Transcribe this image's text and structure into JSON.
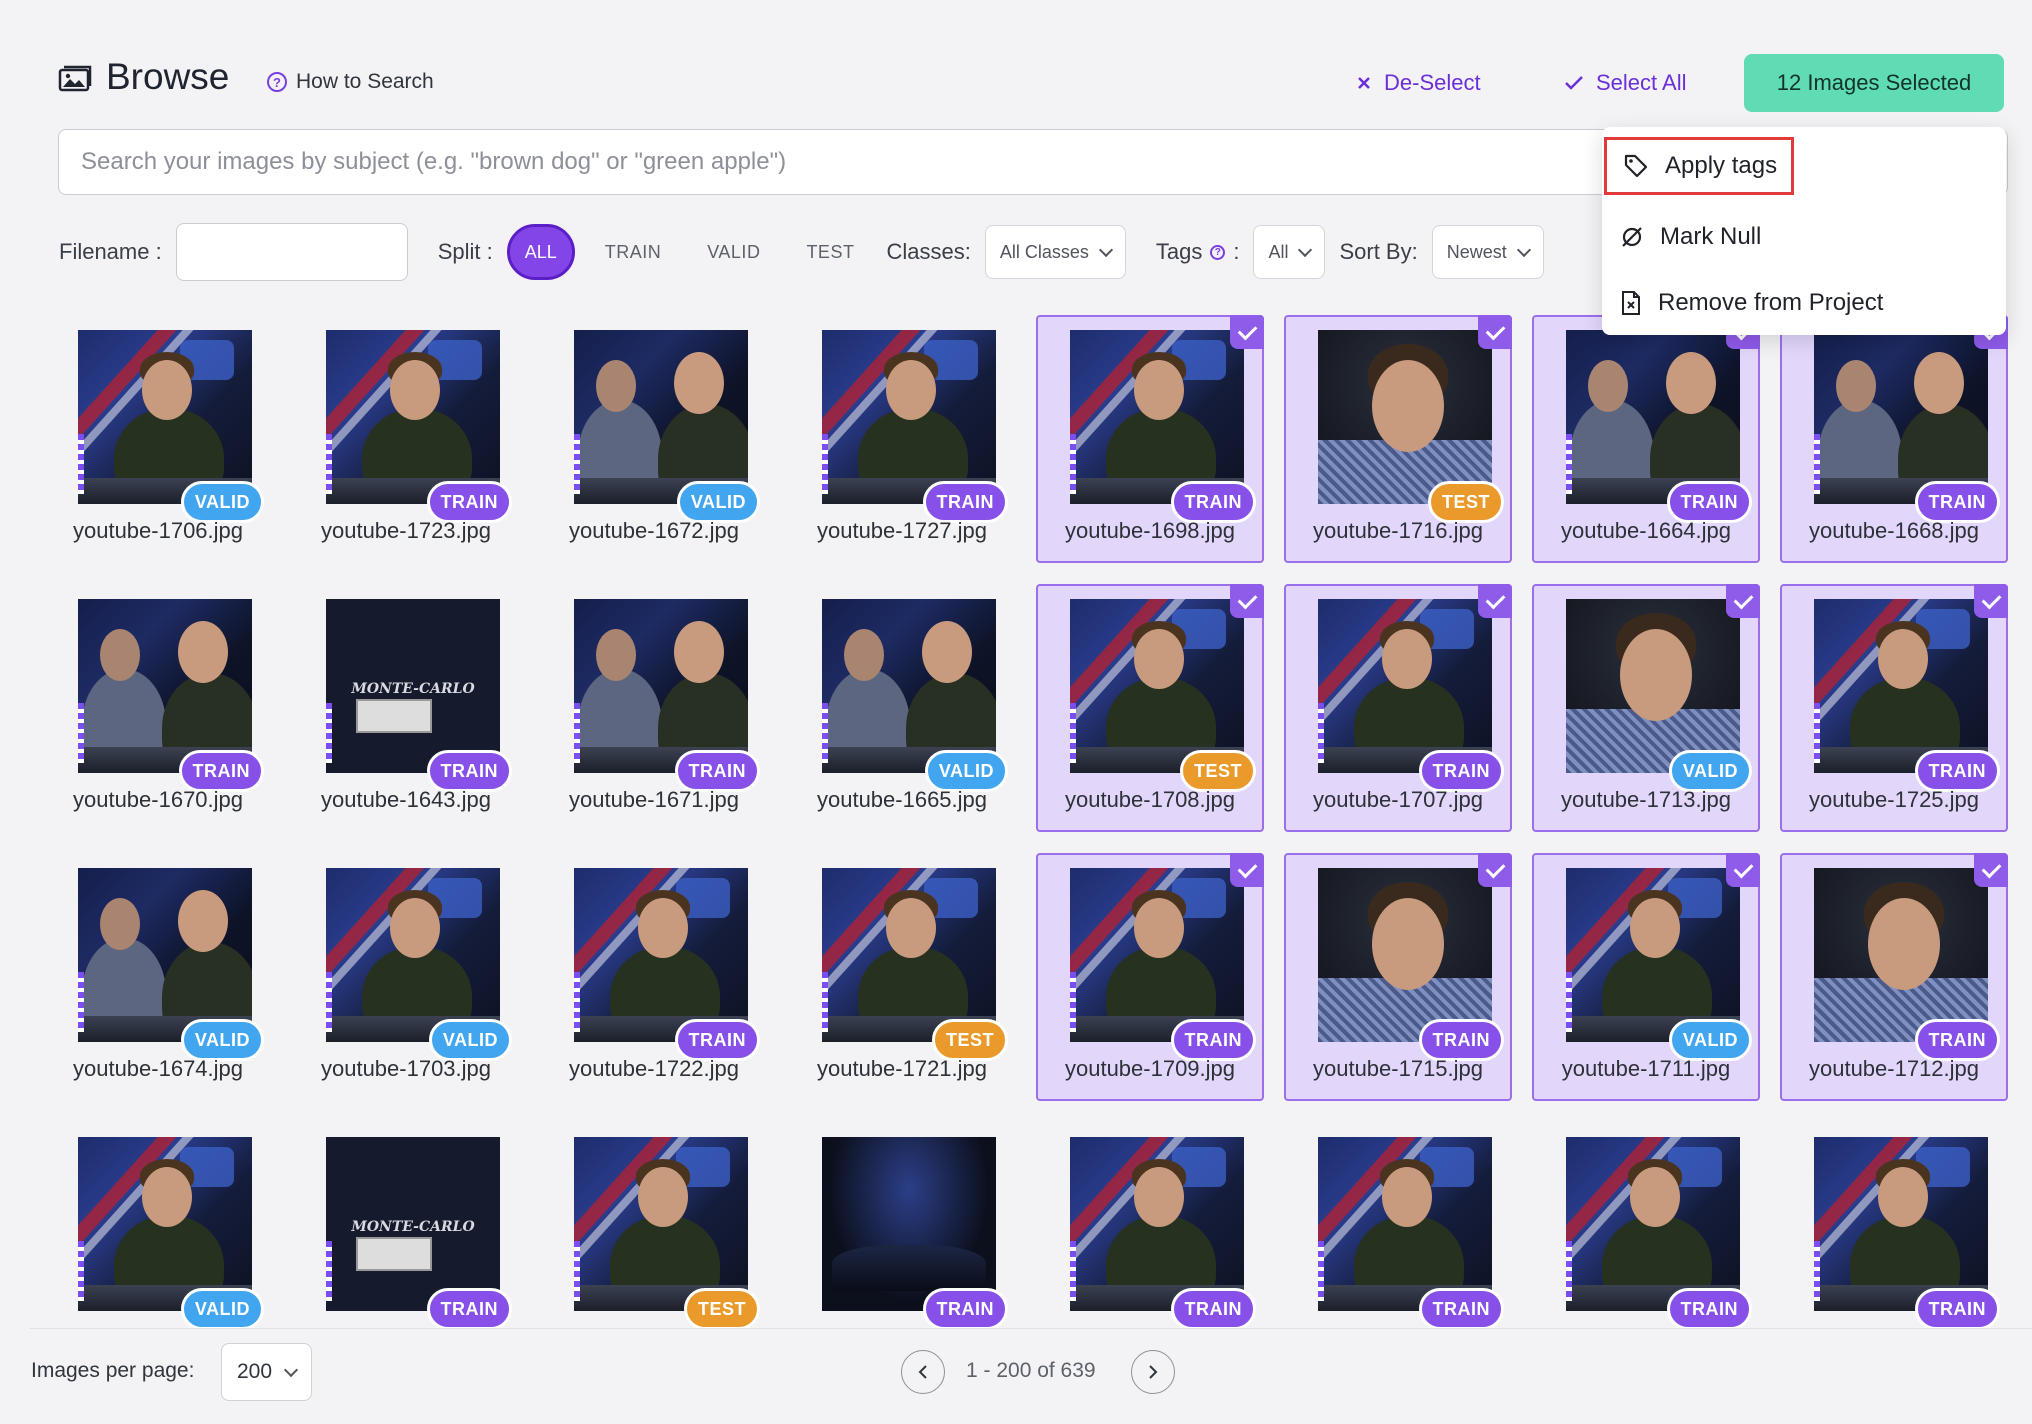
{
  "header": {
    "title": "Browse",
    "how_to_search": "How to Search",
    "deselect": "De-Select",
    "select_all": "Select All",
    "selected_count_label": "12 Images Selected"
  },
  "search": {
    "placeholder": "Search your images by subject (e.g. \"brown dog\" or \"green apple\")"
  },
  "filters": {
    "filename_label": "Filename :",
    "split_label": "Split :",
    "split_options": [
      "ALL",
      "TRAIN",
      "VALID",
      "TEST"
    ],
    "split_selected": "ALL",
    "classes_label": "Classes:",
    "classes_value": "All Classes",
    "tags_label": "Tags",
    "tags_colon": ":",
    "tags_value": "All",
    "sort_label": "Sort By:",
    "sort_value": "Newest"
  },
  "menu": {
    "items": [
      "Apply tags",
      "Mark Null",
      "Remove from Project"
    ]
  },
  "images": [
    {
      "name": "youtube-1706.jpg",
      "split": "VALID",
      "selected": false,
      "art": "stage"
    },
    {
      "name": "youtube-1723.jpg",
      "split": "TRAIN",
      "selected": false,
      "art": "stage"
    },
    {
      "name": "youtube-1672.jpg",
      "split": "VALID",
      "selected": false,
      "art": "two"
    },
    {
      "name": "youtube-1727.jpg",
      "split": "TRAIN",
      "selected": false,
      "art": "stage"
    },
    {
      "name": "youtube-1698.jpg",
      "split": "TRAIN",
      "selected": true,
      "art": "stage"
    },
    {
      "name": "youtube-1716.jpg",
      "split": "TEST",
      "selected": true,
      "art": "close"
    },
    {
      "name": "youtube-1664.jpg",
      "split": "TRAIN",
      "selected": true,
      "art": "two"
    },
    {
      "name": "youtube-1668.jpg",
      "split": "TRAIN",
      "selected": true,
      "art": "two"
    },
    {
      "name": "youtube-1670.jpg",
      "split": "TRAIN",
      "selected": false,
      "art": "two"
    },
    {
      "name": "youtube-1643.jpg",
      "split": "TRAIN",
      "selected": false,
      "art": "mc"
    },
    {
      "name": "youtube-1671.jpg",
      "split": "TRAIN",
      "selected": false,
      "art": "two"
    },
    {
      "name": "youtube-1665.jpg",
      "split": "VALID",
      "selected": false,
      "art": "two"
    },
    {
      "name": "youtube-1708.jpg",
      "split": "TEST",
      "selected": true,
      "art": "stage"
    },
    {
      "name": "youtube-1707.jpg",
      "split": "TRAIN",
      "selected": true,
      "art": "stage"
    },
    {
      "name": "youtube-1713.jpg",
      "split": "VALID",
      "selected": true,
      "art": "close"
    },
    {
      "name": "youtube-1725.jpg",
      "split": "TRAIN",
      "selected": true,
      "art": "stage"
    },
    {
      "name": "youtube-1674.jpg",
      "split": "VALID",
      "selected": false,
      "art": "two"
    },
    {
      "name": "youtube-1703.jpg",
      "split": "VALID",
      "selected": false,
      "art": "stage"
    },
    {
      "name": "youtube-1722.jpg",
      "split": "TRAIN",
      "selected": false,
      "art": "stage"
    },
    {
      "name": "youtube-1721.jpg",
      "split": "TEST",
      "selected": false,
      "art": "stage"
    },
    {
      "name": "youtube-1709.jpg",
      "split": "TRAIN",
      "selected": true,
      "art": "stage"
    },
    {
      "name": "youtube-1715.jpg",
      "split": "TRAIN",
      "selected": true,
      "art": "close"
    },
    {
      "name": "youtube-1711.jpg",
      "split": "VALID",
      "selected": true,
      "art": "stage"
    },
    {
      "name": "youtube-1712.jpg",
      "split": "TRAIN",
      "selected": true,
      "art": "close"
    },
    {
      "name": "",
      "split": "VALID",
      "selected": false,
      "art": "stage"
    },
    {
      "name": "",
      "split": "TRAIN",
      "selected": false,
      "art": "mc"
    },
    {
      "name": "",
      "split": "TEST",
      "selected": false,
      "art": "stage"
    },
    {
      "name": "",
      "split": "TRAIN",
      "selected": false,
      "art": "arena"
    },
    {
      "name": "",
      "split": "TRAIN",
      "selected": false,
      "art": "stage"
    },
    {
      "name": "",
      "split": "TRAIN",
      "selected": false,
      "art": "stage"
    },
    {
      "name": "",
      "split": "TRAIN",
      "selected": false,
      "art": "stage"
    },
    {
      "name": "",
      "split": "TRAIN",
      "selected": false,
      "art": "stage"
    }
  ],
  "thumb_texts": {
    "mc_logo": "MONTE-CARLO"
  },
  "footer": {
    "images_per_page_label": "Images per page:",
    "images_per_page_value": "200",
    "pagination_text": "1 - 200 of 639"
  },
  "colors": {
    "accent": "#7a3fe0",
    "selected_button": "#5fdcb3",
    "badge_train": "#8750e9",
    "badge_valid": "#42a5ef",
    "badge_test": "#ea9a2a",
    "highlight_box": "#e03a3a"
  },
  "icons": {
    "browse": "image-gallery-icon",
    "how_to": "question-circle-icon",
    "deselect": "x-icon",
    "select_all": "checkmark-icon",
    "apply_tags": "tag-icon",
    "mark_null": "empty-set-icon",
    "remove": "file-x-icon"
  }
}
